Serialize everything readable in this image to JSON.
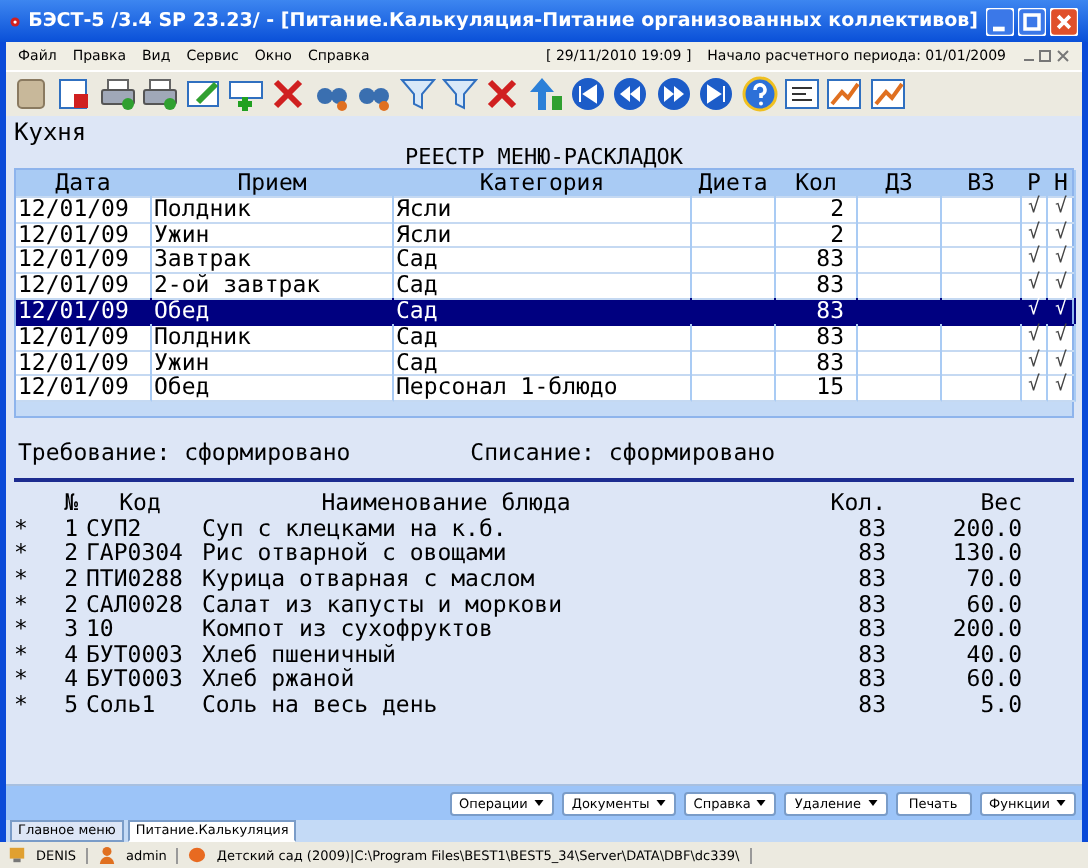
{
  "window": {
    "title": "БЭСТ-5 /3.4 SP 23.23/ - [Питание.Калькуляция-Питание организованных коллективов]"
  },
  "menu": [
    "Файл",
    "Правка",
    "Вид",
    "Сервис",
    "Окно",
    "Справка"
  ],
  "menu_info": {
    "datetime": "[ 29/11/2010 19:09 ]",
    "period": "Начало расчетного периода: 01/01/2009"
  },
  "section": "Кухня",
  "registry": {
    "title": "РЕЕСТР МЕНЮ-РАСКЛАДОК",
    "columns": [
      "Дата",
      "Прием",
      "Категория",
      "Диета",
      "Кол",
      "ДЗ",
      "ВЗ",
      "Р",
      "Н"
    ],
    "rows": [
      {
        "date": "12/01/09",
        "meal": "Полдник",
        "category": "Ясли",
        "qty": "2",
        "r": "√",
        "n": "√",
        "selected": false
      },
      {
        "date": "12/01/09",
        "meal": "Ужин",
        "category": "Ясли",
        "qty": "2",
        "r": "√",
        "n": "√",
        "selected": false
      },
      {
        "date": "12/01/09",
        "meal": "Завтрак",
        "category": "Сад",
        "qty": "83",
        "r": "√",
        "n": "√",
        "selected": false
      },
      {
        "date": "12/01/09",
        "meal": "2-ой завтрак",
        "category": "Сад",
        "qty": "83",
        "r": "√",
        "n": "√",
        "selected": false
      },
      {
        "date": "12/01/09",
        "meal": "Обед",
        "category": "Сад",
        "qty": "83",
        "r": "√",
        "n": "√",
        "selected": true
      },
      {
        "date": "12/01/09",
        "meal": "Полдник",
        "category": "Сад",
        "qty": "83",
        "r": "√",
        "n": "√",
        "selected": false
      },
      {
        "date": "12/01/09",
        "meal": "Ужин",
        "category": "Сад",
        "qty": "83",
        "r": "√",
        "n": "√",
        "selected": false
      },
      {
        "date": "12/01/09",
        "meal": "Обед",
        "category": "Персонал 1-блюдо",
        "qty": "15",
        "r": "√",
        "n": "√",
        "selected": false
      }
    ]
  },
  "status_lines": [
    "Требование: сформировано",
    "Списание: сформировано"
  ],
  "dishes": {
    "columns": [
      "№",
      "Код",
      "Наименование блюда",
      "Кол.",
      "Вес"
    ],
    "rows": [
      {
        "mark": "*",
        "num": "1",
        "code": "СУП2",
        "name": "Суп с клецками на к.б.",
        "qty": "83",
        "weight": "200.0"
      },
      {
        "mark": "*",
        "num": "2",
        "code": "ГАР0304",
        "name": "Рис отварной с овощами",
        "qty": "83",
        "weight": "130.0"
      },
      {
        "mark": "*",
        "num": "2",
        "code": "ПТИ0288",
        "name": "Курица отварная с маслом",
        "qty": "83",
        "weight": "70.0"
      },
      {
        "mark": "*",
        "num": "2",
        "code": "САЛ0028",
        "name": "Салат из капусты и моркови",
        "qty": "83",
        "weight": "60.0"
      },
      {
        "mark": "*",
        "num": "3",
        "code": "10",
        "name": "Компот из сухофруктов",
        "qty": "83",
        "weight": "200.0"
      },
      {
        "mark": "*",
        "num": "4",
        "code": "БУТ0003",
        "name": "Хлеб пшеничный",
        "qty": "83",
        "weight": "40.0"
      },
      {
        "mark": "*",
        "num": "4",
        "code": "БУТ0003",
        "name": "Хлеб ржаной",
        "qty": "83",
        "weight": "60.0"
      },
      {
        "mark": "*",
        "num": "5",
        "code": "Соль1",
        "name": "Соль на весь день",
        "qty": "83",
        "weight": "5.0"
      }
    ]
  },
  "buttons": [
    {
      "label": "Операции",
      "dropdown": true
    },
    {
      "label": "Документы",
      "dropdown": true
    },
    {
      "label": "Справка",
      "dropdown": true
    },
    {
      "label": "Удаление",
      "dropdown": true
    },
    {
      "label": "Печать",
      "dropdown": false
    },
    {
      "label": "Функции",
      "dropdown": true
    }
  ],
  "tabs": [
    {
      "label": "Главное меню",
      "selected": false
    },
    {
      "label": "Питание.Калькуляция",
      "selected": true
    }
  ],
  "status_bar": {
    "host": "DENIS",
    "user": "admin",
    "path": "Детский сад (2009)|C:\\Program Files\\BEST1\\BEST5_34\\Server\\DATA\\DBF\\dc339\\"
  }
}
